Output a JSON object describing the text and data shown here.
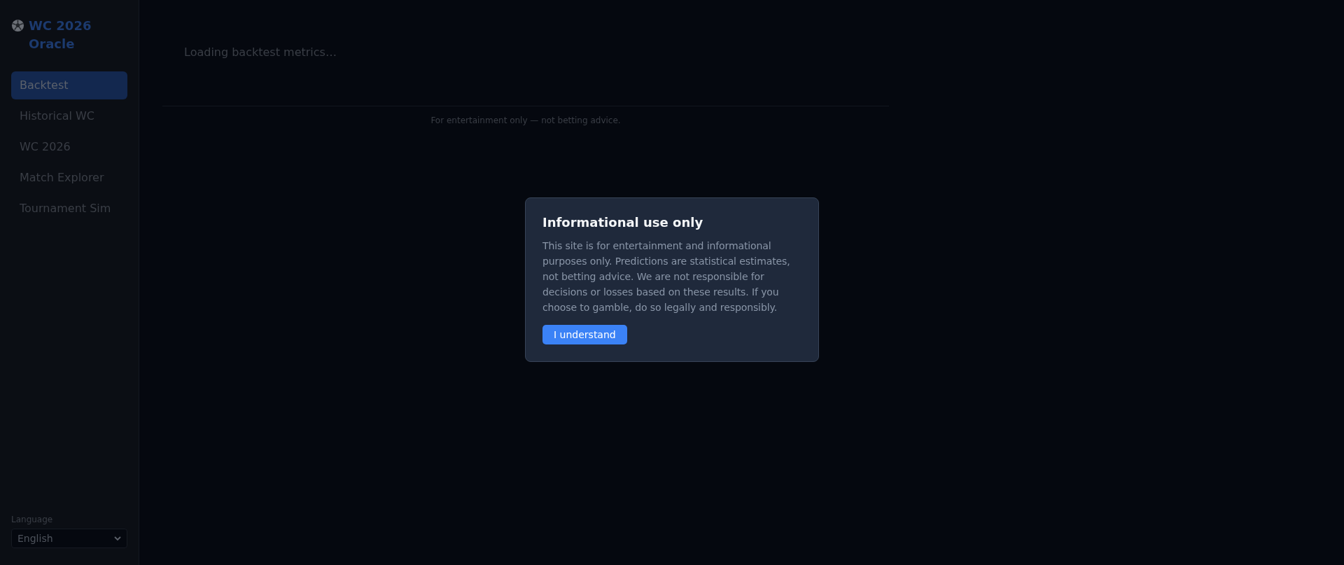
{
  "sidebar": {
    "logo": "WC 2026 Oracle",
    "items": [
      {
        "label": "Backtest",
        "selected": true
      },
      {
        "label": "Historical WC",
        "selected": false
      },
      {
        "label": "WC 2026",
        "selected": false
      },
      {
        "label": "Match Explorer",
        "selected": false
      },
      {
        "label": "Tournament Sim",
        "selected": false
      }
    ],
    "language": {
      "label": "Language",
      "value": "English"
    }
  },
  "main": {
    "loading": "Loading backtest metrics…",
    "footer": "For entertainment only — not betting advice."
  },
  "modal": {
    "title": "Informational use only",
    "body": "This site is for entertainment and informational purposes only. Predictions are statistical estimates, not betting advice. We are not responsible for decisions or losses based on these results. If you choose to gamble, do so legally and responsibly.",
    "button": "I understand"
  }
}
